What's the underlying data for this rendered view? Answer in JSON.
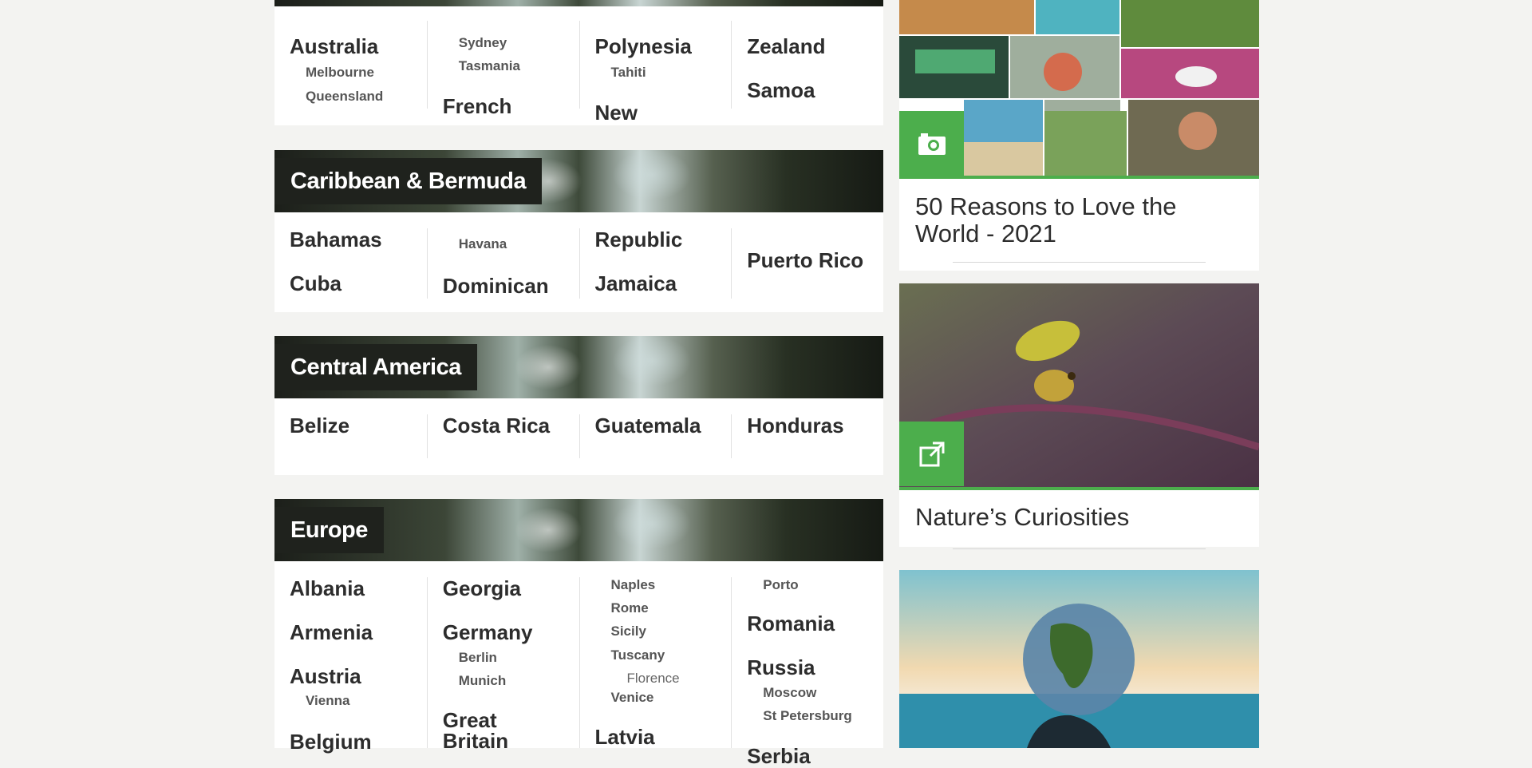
{
  "regions": {
    "australasia": {
      "col1": [
        "Australia",
        "Melbourne",
        "Queensland"
      ],
      "col2": [
        "Sydney",
        "Tasmania",
        "French"
      ],
      "col3": [
        "Polynesia",
        "Tahiti",
        "New"
      ],
      "col4": [
        "Zealand",
        "Samoa"
      ]
    },
    "caribbean": {
      "title": "Caribbean & Bermuda",
      "col1": [
        "Bahamas",
        "Cuba"
      ],
      "col2": [
        "Havana",
        "Dominican"
      ],
      "col3": [
        "Republic",
        "Jamaica"
      ],
      "col4": [
        "Puerto Rico"
      ]
    },
    "central_america": {
      "title": "Central America",
      "countries": [
        "Belize",
        "Costa Rica",
        "Guatemala",
        "Honduras"
      ]
    },
    "europe": {
      "title": "Europe",
      "col1": [
        "Albania",
        "Armenia",
        "Austria",
        "Vienna",
        "Belgium"
      ],
      "col2": [
        "Georgia",
        "Germany",
        "Berlin",
        "Munich",
        "Great",
        "Britain"
      ],
      "col3": [
        "Naples",
        "Rome",
        "Sicily",
        "Tuscany",
        "Florence",
        "Venice",
        "Latvia"
      ],
      "col4": [
        "Porto",
        "Romania",
        "Russia",
        "Moscow",
        "St Petersburg",
        "Serbia"
      ]
    }
  },
  "sidebar": {
    "card1": {
      "title": "50 Reasons to Love the World - 2021",
      "icon": "camera-icon"
    },
    "card2": {
      "title": "Nature’s Curiosities",
      "icon": "external-link-icon"
    },
    "card3": {
      "icon": "globe-in-hand-image"
    }
  },
  "colors": {
    "accent": "#4cae4c",
    "banner_label_bg": "#1f221d"
  }
}
